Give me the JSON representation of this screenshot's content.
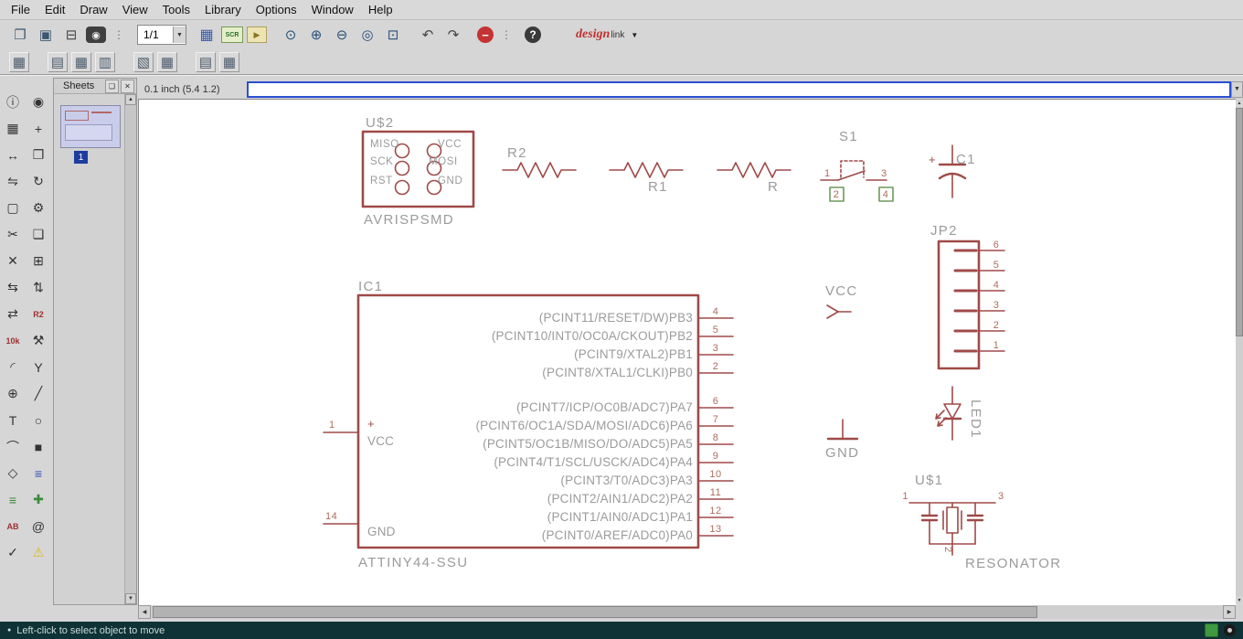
{
  "menu": [
    "File",
    "Edit",
    "Draw",
    "View",
    "Tools",
    "Library",
    "Options",
    "Window",
    "Help"
  ],
  "toolbar": {
    "sheet_selector": "1/1",
    "script_label": "SCR",
    "designlink": {
      "part1": "design",
      "part2": "link"
    }
  },
  "icons": {
    "open": "❐",
    "save": "▣",
    "print": "⊟",
    "cam": "◉",
    "grid": "▦",
    "ulp": "▶",
    "zoom_fit": "⊙",
    "zoom_in": "⊕",
    "zoom_out": "⊖",
    "zoom_redraw": "◎",
    "zoom_select": "⊡",
    "undo": "↶",
    "redo": "↷",
    "stop": "−",
    "dots": "⋮",
    "help": "?",
    "chevron_down": "▼",
    "detach": "❏",
    "close": "✕",
    "scroll_up": "▲",
    "scroll_down": "▼",
    "scroll_left": "◀",
    "scroll_right": "▶",
    "bullet": "●"
  },
  "layer_icons": [
    {
      "name": "window-layout-icon",
      "glyph": "▦"
    },
    {
      "name": "layer-view-icon-1",
      "glyph": "▤",
      "cls": "gap"
    },
    {
      "name": "layer-view-icon-2",
      "glyph": "▦"
    },
    {
      "name": "layer-view-icon-3",
      "glyph": "▥"
    },
    {
      "name": "layer-view-icon-4",
      "glyph": "▧",
      "cls": "gap"
    },
    {
      "name": "layer-view-icon-5",
      "glyph": "▦"
    },
    {
      "name": "layer-view-icon-6",
      "glyph": "▤",
      "cls": "gap"
    },
    {
      "name": "layer-view-icon-7",
      "glyph": "▦"
    }
  ],
  "palette": [
    {
      "name": "info-tool-icon",
      "glyph": "ⓘ"
    },
    {
      "name": "show-tool-icon",
      "glyph": "◉"
    },
    {
      "name": "display-tool-icon",
      "glyph": "▦"
    },
    {
      "name": "mark-tool-icon",
      "glyph": "+"
    },
    {
      "name": "move-tool-icon",
      "glyph": "↔"
    },
    {
      "name": "copy-tool-icon",
      "glyph": "❐"
    },
    {
      "name": "mirror-tool-icon",
      "glyph": "⇋"
    },
    {
      "name": "rotate-tool-icon",
      "glyph": "↻"
    },
    {
      "name": "group-tool-icon",
      "glyph": "▢"
    },
    {
      "name": "change-tool-icon",
      "glyph": "⚙"
    },
    {
      "name": "cut-tool-icon",
      "glyph": "✂"
    },
    {
      "name": "paste-tool-icon",
      "glyph": "❏"
    },
    {
      "name": "delete-tool-icon",
      "glyph": "✕"
    },
    {
      "name": "add-tool-icon",
      "glyph": "⊞"
    },
    {
      "name": "pinswap-tool-icon",
      "glyph": "⇆"
    },
    {
      "name": "gateswap-tool-icon",
      "glyph": "⇅"
    },
    {
      "name": "replace-tool-icon",
      "glyph": "⇄"
    },
    {
      "name": "name-tool-icon",
      "glyph": "R2",
      "cls": "red-text"
    },
    {
      "name": "value-tool-icon",
      "glyph": "10k",
      "cls": "red-text"
    },
    {
      "name": "smash-tool-icon",
      "glyph": "⚒"
    },
    {
      "name": "miter-tool-icon",
      "glyph": "◜"
    },
    {
      "name": "split-tool-icon",
      "glyph": "Y"
    },
    {
      "name": "invoke-tool-icon",
      "glyph": "⊕"
    },
    {
      "name": "wire-tool-icon",
      "glyph": "╱"
    },
    {
      "name": "text-tool-icon",
      "glyph": "T"
    },
    {
      "name": "circle-tool-icon",
      "glyph": "○"
    },
    {
      "name": "arc-tool-icon",
      "glyph": "⌒"
    },
    {
      "name": "rect-tool-icon",
      "glyph": "■"
    },
    {
      "name": "polygon-tool-icon",
      "glyph": "◇"
    },
    {
      "name": "bus-tool-icon",
      "glyph": "≡",
      "cls": "blue"
    },
    {
      "name": "net-tool-icon",
      "glyph": "≡",
      "cls": "green"
    },
    {
      "name": "junction-tool-icon",
      "glyph": "✚",
      "cls": "green"
    },
    {
      "name": "label-tool-icon",
      "glyph": "AB",
      "cls": "red-text"
    },
    {
      "name": "attribute-tool-icon",
      "glyph": "@"
    },
    {
      "name": "erc-tool-icon",
      "glyph": "✓"
    },
    {
      "name": "errors-tool-icon",
      "glyph": "⚠",
      "cls": "yellow"
    }
  ],
  "sheets_panel": {
    "title": "Sheets",
    "sheet_number": "1"
  },
  "command_bar": {
    "coordinates": "0.1 inch (5.4 1.2)",
    "input_value": ""
  },
  "status_bar": {
    "message": "Left-click to select object to move"
  },
  "schematic": {
    "u2": {
      "ref": "U$2",
      "value": "AVRISPSMD",
      "pin_labels": [
        "MISO",
        "VCC",
        "SCK",
        "MOSI",
        "RST",
        "GND"
      ]
    },
    "r2": {
      "ref": "R2"
    },
    "r1": {
      "ref": "R1"
    },
    "r": {
      "ref": "R"
    },
    "s1": {
      "ref": "S1",
      "pin_nums": [
        "1",
        "2",
        "3",
        "4"
      ]
    },
    "c1": {
      "ref": "C1",
      "polarity": "+"
    },
    "jp2": {
      "ref": "JP2",
      "pin_nums": [
        "6",
        "5",
        "4",
        "3",
        "2",
        "1"
      ]
    },
    "vcc": {
      "label": "VCC"
    },
    "gnd": {
      "label": "GND"
    },
    "led1": {
      "ref": "LED1"
    },
    "u1": {
      "ref": "U$1",
      "value": "RESONATOR",
      "pin_nums": [
        "1",
        "3",
        "2"
      ]
    },
    "ic1": {
      "ref": "IC1",
      "value": "ATTINY44-SSU",
      "vcc_plus": "+",
      "vcc_label": "VCC",
      "gnd_label": "GND",
      "left_pins": [
        {
          "num": "1"
        },
        {
          "num": "14"
        }
      ],
      "right_pins": [
        {
          "num": "4",
          "name": "(PCINT11/RESET/DW)PB3"
        },
        {
          "num": "5",
          "name": "(PCINT10/INT0/OC0A/CKOUT)PB2"
        },
        {
          "num": "3",
          "name": "(PCINT9/XTAL2)PB1"
        },
        {
          "num": "2",
          "name": "(PCINT8/XTAL1/CLKI)PB0"
        },
        {
          "num": "6",
          "name": "(PCINT7/ICP/OC0B/ADC7)PA7"
        },
        {
          "num": "7",
          "name": "(PCINT6/OC1A/SDA/MOSI/ADC6)PA6"
        },
        {
          "num": "8",
          "name": "(PCINT5/OC1B/MISO/DO/ADC5)PA5"
        },
        {
          "num": "9",
          "name": "(PCINT4/T1/SCL/USCK/ADC4)PA4"
        },
        {
          "num": "10",
          "name": "(PCINT3/T0/ADC3)PA3"
        },
        {
          "num": "11",
          "name": "(PCINT2/AIN1/ADC2)PA2"
        },
        {
          "num": "12",
          "name": "(PCINT1/AIN0/ADC1)PA1"
        },
        {
          "num": "13",
          "name": "(PCINT0/AREF/ADC0)PA0"
        }
      ]
    }
  }
}
